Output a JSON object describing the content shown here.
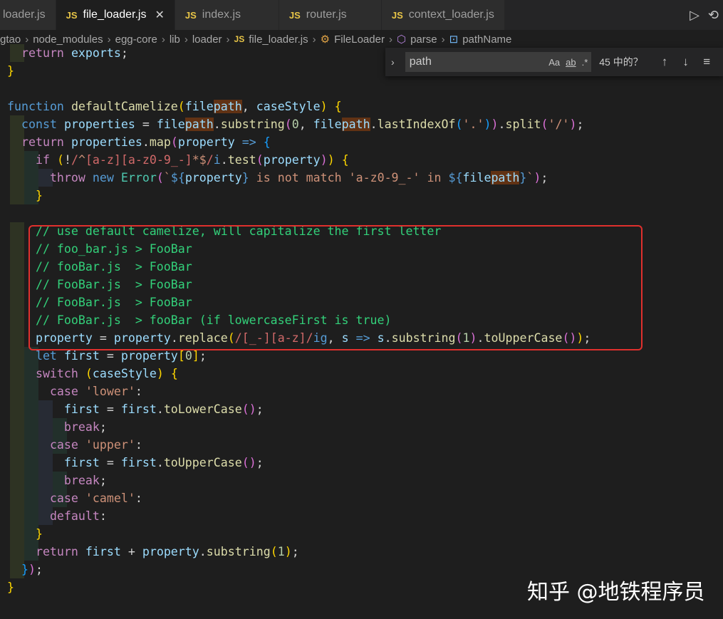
{
  "tabs": [
    {
      "label": "loader.js",
      "active": false
    },
    {
      "label": "file_loader.js",
      "active": true
    },
    {
      "label": "index.js",
      "active": false
    },
    {
      "label": "router.js",
      "active": false
    },
    {
      "label": "context_loader.js",
      "active": false
    }
  ],
  "tab_js_badge": "JS",
  "tab_close_glyph": "✕",
  "breadcrumb": {
    "parts": [
      "gtao",
      "node_modules",
      "egg-core",
      "lib",
      "loader",
      "file_loader.js",
      "FileLoader",
      "parse",
      "pathName"
    ]
  },
  "find": {
    "value": "path",
    "match_case": "Aa",
    "whole_word": "ab",
    "regex": ".*",
    "count": "45 中的？"
  },
  "code_lines": [
    "  return exports;",
    "}",
    "",
    "function defaultCamelize(filepath, caseStyle) {",
    "  const properties = filepath.substring(0, filepath.lastIndexOf('.')).split('/');",
    "  return properties.map(property => {",
    "    if (!/^[a-z][a-z0-9_-]*$/i.test(property)) {",
    "      throw new Error(`${property} is not match 'a-z0-9_-' in ${filepath}`);",
    "    }",
    "",
    "    // use default camelize, will capitalize the first letter",
    "    // foo_bar.js > FooBar",
    "    // fooBar.js  > FooBar",
    "    // FooBar.js  > FooBar",
    "    // FooBar.js  > FooBar",
    "    // FooBar.js  > fooBar (if lowercaseFirst is true)",
    "    property = property.replace(/[_-][a-z]/ig, s => s.substring(1).toUpperCase());",
    "    let first = property[0];",
    "    switch (caseStyle) {",
    "      case 'lower':",
    "        first = first.toLowerCase();",
    "        break;",
    "      case 'upper':",
    "        first = first.toUpperCase();",
    "        break;",
    "      case 'camel':",
    "      default:",
    "    }",
    "    return first + property.substring(1);",
    "  });",
    "}"
  ],
  "watermark": "知乎 @地铁程序员"
}
